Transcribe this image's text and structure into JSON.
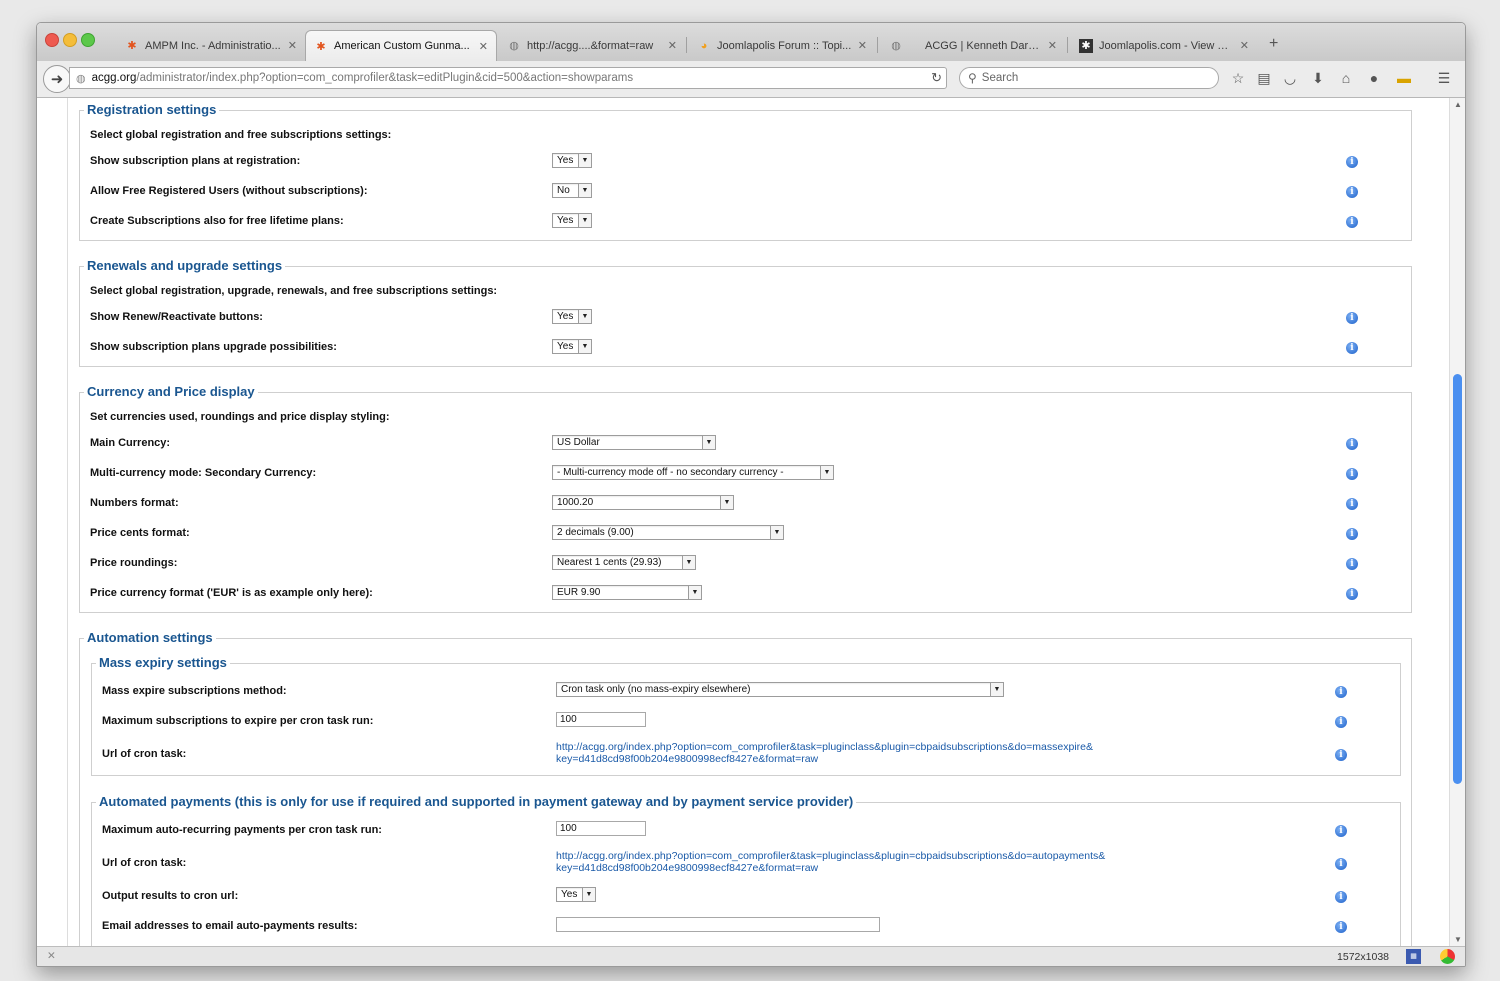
{
  "tabs": [
    {
      "label": "AMPM Inc. - Administratio...",
      "icon": "joomla-icon"
    },
    {
      "label": "American Custom Gunma...",
      "icon": "joomla-icon",
      "active": true
    },
    {
      "label": "http://acgg....&format=raw",
      "icon": "globe-icon"
    },
    {
      "label": "Joomlapolis Forum :: Topi...",
      "icon": "joomlapolis-icon"
    },
    {
      "label": "ACGG | Kenneth Darr Jr",
      "icon": "globe-icon"
    },
    {
      "label": "Joomlapolis.com - View Ti...",
      "icon": "joomla-icon"
    }
  ],
  "new_tab": "+",
  "tab_close": "✕",
  "url": {
    "host": "acgg.org",
    "path": "/administrator/index.php?option=com_comprofiler&task=editPlugin&cid=500&action=showparams"
  },
  "search_placeholder": "Search",
  "sections": {
    "registration": {
      "title": "Registration settings",
      "desc": "Select global registration and free subscriptions settings:",
      "rows": [
        {
          "label": "Show subscription plans at registration:",
          "value": "Yes"
        },
        {
          "label": "Allow Free Registered Users (without subscriptions):",
          "value": "No"
        },
        {
          "label": "Create Subscriptions also for free lifetime plans:",
          "value": "Yes"
        }
      ]
    },
    "renewals": {
      "title": "Renewals and upgrade settings",
      "desc": "Select global registration, upgrade, renewals, and free subscriptions settings:",
      "rows": [
        {
          "label": "Show Renew/Reactivate buttons:",
          "value": "Yes"
        },
        {
          "label": "Show subscription plans upgrade possibilities:",
          "value": "Yes"
        }
      ]
    },
    "currency": {
      "title": "Currency and Price display",
      "desc": "Set currencies used, roundings and price display styling:",
      "rows": [
        {
          "label": "Main Currency:",
          "value": "US Dollar"
        },
        {
          "label": "Multi-currency mode: Secondary Currency:",
          "value": "- Multi-currency mode off - no secondary currency -"
        },
        {
          "label": "Numbers format:",
          "value": "1000.20"
        },
        {
          "label": "Price cents format:",
          "value": "2 decimals (9.00)"
        },
        {
          "label": "Price roundings:",
          "value": "Nearest 1 cents (29.93)"
        },
        {
          "label": "Price currency format ('EUR' is as example only here):",
          "value": "EUR 9.90"
        }
      ]
    },
    "automation": {
      "title": "Automation settings",
      "mass_expiry": {
        "title": "Mass expiry settings",
        "method_label": "Mass expire subscriptions method:",
        "method_value": "Cron task only (no mass-expiry elsewhere)",
        "max_label": "Maximum subscriptions to expire per cron task run:",
        "max_value": "100",
        "url_label": "Url of cron task:",
        "url_line1": "http://acgg.org/index.php?option=com_comprofiler&task=pluginclass&plugin=cbpaidsubscriptions&do=massexpire&",
        "url_line2": "key=d41d8cd98f00b204e9800998ecf8427e&format=raw"
      },
      "auto_payments": {
        "title": "Automated payments (this is only for use if required and supported in payment gateway and by payment service provider)",
        "max_label": "Maximum auto-recurring payments per cron task run:",
        "max_value": "100",
        "url_label": "Url of cron task:",
        "url_line1": "http://acgg.org/index.php?option=com_comprofiler&task=pluginclass&plugin=cbpaidsubscriptions&do=autopayments&",
        "url_line2": "key=d41d8cd98f00b204e9800998ecf8427e&format=raw",
        "output_label": "Output results to cron url:",
        "output_value": "Yes",
        "email_label": "Email addresses to email auto-payments results:",
        "email_value": ""
      }
    }
  },
  "status": {
    "dimensions": "1572x1038"
  }
}
